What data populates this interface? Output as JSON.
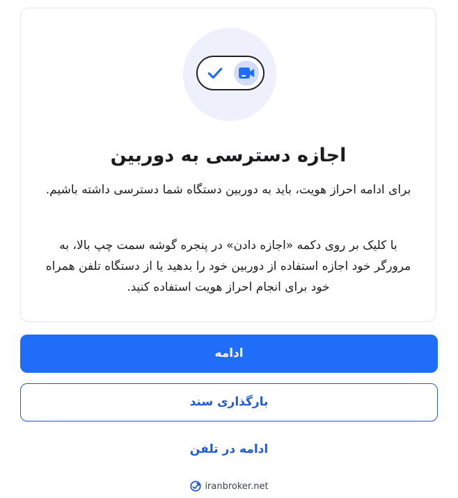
{
  "colors": {
    "primary": "#1f6df8",
    "link": "#1f5ad6",
    "illustration_bg": "#eef1fb",
    "knob_bg": "#d3ddf7"
  },
  "illustration": {
    "toggle_icon": "check-icon",
    "knob_icon": "video-camera-icon"
  },
  "card": {
    "title": "اجازه دسترسی به دوربین",
    "paragraph1": "برای ادامه احراز هویت، باید به دوربین دستگاه شما دسترسی داشته باشیم.",
    "paragraph2": "با کلیک بر روی دکمه «اجازه دادن» در پنجره گوشه سمت چپ بالا، به مرورگر خود اجازه استفاده از دوربین خود را بدهید یا از دستگاه تلفن همراه خود برای انجام احراز هویت استفاده کنید."
  },
  "actions": {
    "continue_label": "ادامه",
    "upload_label": "بارگذاری سند",
    "continue_on_phone_label": "ادامه در تلفن"
  },
  "footer": {
    "brand_text": "iranbroker.net",
    "brand_icon": "iranbroker-logo-icon"
  }
}
